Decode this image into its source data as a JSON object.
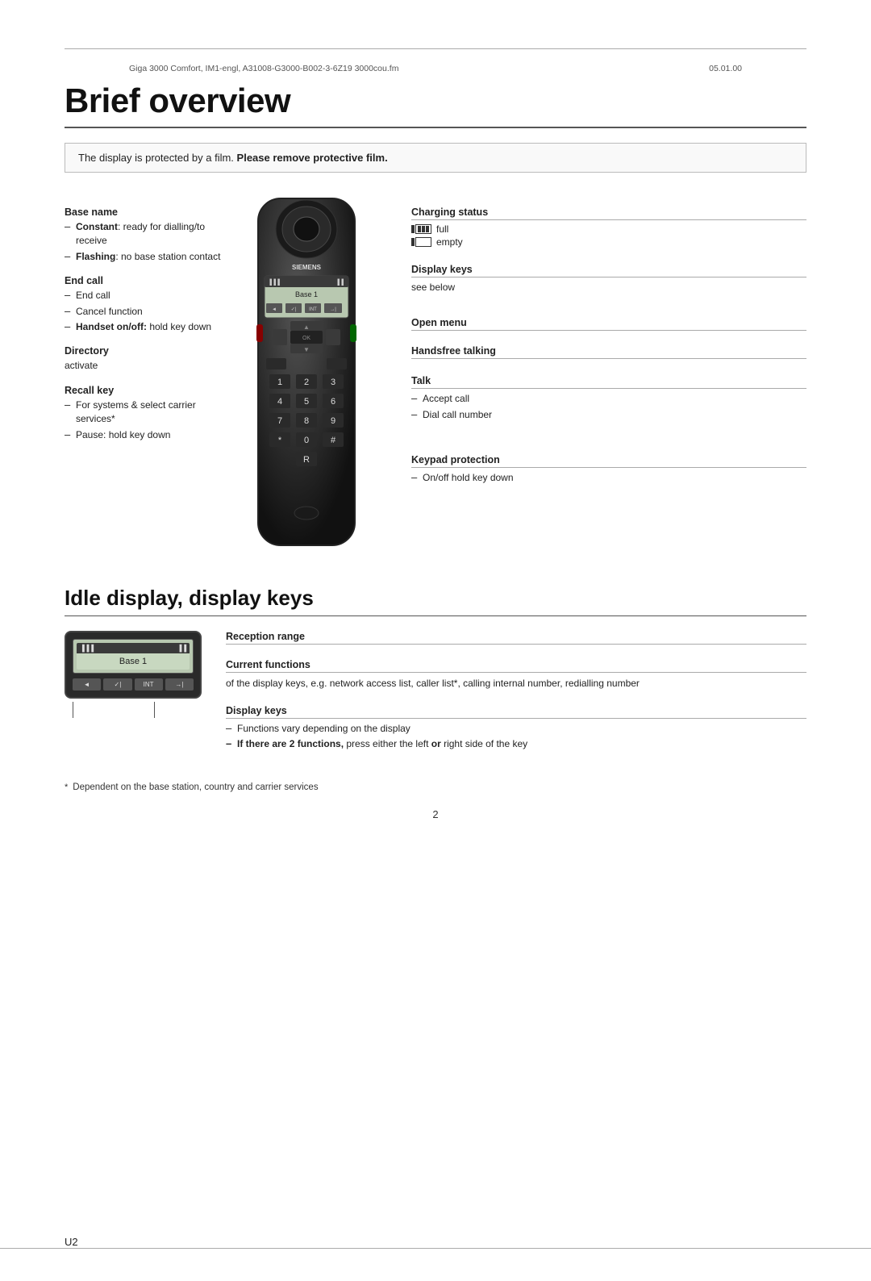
{
  "meta": {
    "left": "Giga 3000 Comfort, IM1-engl, A31008-G3000-B002-3-6Z19   3000cou.fm",
    "right": "05.01.00"
  },
  "page_title": "Brief overview",
  "notice": {
    "prefix": "The display is protected by a film.",
    "bold_text": "Please remove protective film."
  },
  "left_annotations": [
    {
      "id": "base-name",
      "title": "Base name",
      "items": [
        {
          "bold": "Constant",
          "text": ": ready for dialling/to receive"
        },
        {
          "bold": "Flashing",
          "text": ": no base station contact"
        }
      ]
    },
    {
      "id": "end-call",
      "title": "End call",
      "items": [
        {
          "text": "End call"
        },
        {
          "text": "Cancel function"
        },
        {
          "bold": "Handset on/off",
          "text": ": hold key down",
          "dash_bold": true
        }
      ]
    },
    {
      "id": "directory",
      "title": "Directory",
      "items": [
        {
          "text": "activate",
          "no_dash": true
        }
      ]
    },
    {
      "id": "recall-key",
      "title": "Recall key",
      "items": [
        {
          "text": "For systems & select carrier services*"
        },
        {
          "text": "Pause: hold key down"
        }
      ]
    }
  ],
  "right_annotations": [
    {
      "id": "charging-status",
      "title": "Charging status",
      "items": [
        {
          "icon": "battery-full",
          "text": "full"
        },
        {
          "icon": "battery-empty",
          "text": "empty"
        }
      ]
    },
    {
      "id": "display-keys",
      "title": "Display keys",
      "items": [
        {
          "text": "see below",
          "no_dash": true
        }
      ]
    },
    {
      "id": "open-menu",
      "title": "Open menu",
      "items": []
    },
    {
      "id": "handsfree-talking",
      "title": "Handsfree talking",
      "items": []
    },
    {
      "id": "talk",
      "title": "Talk",
      "items": [
        {
          "text": "Accept call"
        },
        {
          "text": "Dial call number"
        }
      ]
    },
    {
      "id": "keypad-protection",
      "title": "Keypad protection",
      "items": [
        {
          "text": "On/off hold key down"
        }
      ]
    }
  ],
  "idle_section": {
    "title": "Idle display, display keys",
    "display": {
      "brand": "SIEMENS",
      "signal": "▐▐▐",
      "battery": "▐▐",
      "base_label": "Base 1",
      "buttons": [
        "◄",
        "✓|",
        "INT",
        "→|"
      ]
    },
    "right_annotations": [
      {
        "id": "reception-range",
        "title": "Reception range",
        "items": []
      },
      {
        "id": "current-functions",
        "title": "Current functions",
        "text": "of the display keys, e.g. network access list, caller list*, calling internal number, redialling number"
      },
      {
        "id": "display-keys-idle",
        "title": "Display keys",
        "items": [
          {
            "text": "Functions vary depending on the display"
          },
          {
            "bold": "If there are 2 functions,",
            "text": " press either the left ",
            "bold2": "or",
            "text2": " right side of the key"
          }
        ]
      }
    ]
  },
  "footnote": {
    "star": "*",
    "text": "Dependent on the base station, country and carrier services"
  },
  "page_number": "2",
  "bottom": {
    "left": "U2",
    "right": ""
  }
}
